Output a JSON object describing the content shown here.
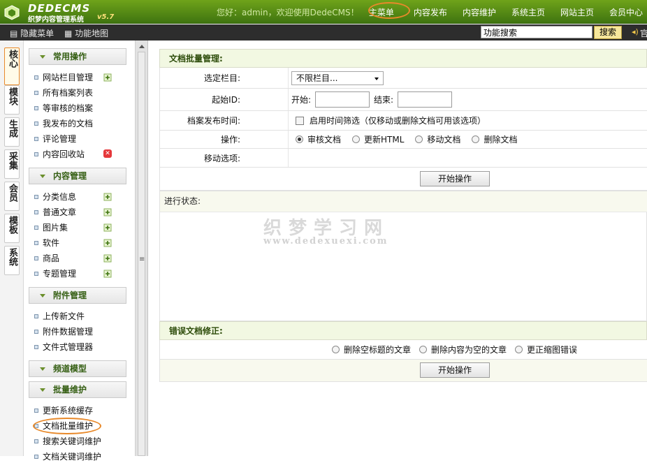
{
  "app": {
    "brand": "DEDECMS",
    "subtitle": "织梦内容管理系统",
    "version": "v5.7"
  },
  "header": {
    "welcome": "您好：admin，欢迎使用DedeCMS！",
    "nav": [
      "主菜单",
      "内容发布",
      "内容维护",
      "系统主页",
      "网站主页",
      "会员中心"
    ]
  },
  "toolbar": {
    "hide_menu": "隐藏菜单",
    "func_map": "功能地图",
    "search_value": "功能搜索",
    "search_button": "搜索",
    "tail": "官"
  },
  "left_tabs": [
    "核心",
    "模块",
    "生成",
    "采集",
    "会员",
    "模板",
    "系统"
  ],
  "menu": {
    "groups": [
      {
        "title": "常用操作",
        "items": [
          "网站栏目管理",
          "所有档案列表",
          "等审核的档案",
          "我发布的文档",
          "评论管理",
          "内容回收站"
        ]
      },
      {
        "title": "内容管理",
        "items": [
          "分类信息",
          "普通文章",
          "图片集",
          "软件",
          "商品",
          "专题管理"
        ]
      },
      {
        "title": "附件管理",
        "items": [
          "上传新文件",
          "附件数据管理",
          "文件式管理器"
        ]
      },
      {
        "title": "频道模型",
        "items": []
      },
      {
        "title": "批量维护",
        "items": [
          "更新系统缓存",
          "文档批量维护",
          "搜索关键词维护",
          "文档关键词维护"
        ]
      }
    ]
  },
  "main": {
    "title": "文档批量管理:",
    "rows": {
      "category_label": "选定栏目:",
      "category_value": "不限栏目...",
      "startid_label": "起始ID:",
      "start_label": "开始:",
      "end_label": "结束:",
      "time_label": "档案发布时间:",
      "time_checkbox": "启用时间筛选（仅移动或删除文档可用该选项）",
      "op_label": "操作:",
      "ops": [
        "审核文档",
        "更新HTML",
        "移动文档",
        "删除文档"
      ],
      "move_label": "移动选项:"
    },
    "start_button": "开始操作",
    "status_label": "进行状态:",
    "watermark_cn": "织梦学习网",
    "watermark_en": "www.dedexuexi.com",
    "error_title": "错误文档修正:",
    "error_options": [
      "删除空标题的文章",
      "删除内容为空的文章",
      "更正缩图错误"
    ],
    "start_button2": "开始操作"
  }
}
